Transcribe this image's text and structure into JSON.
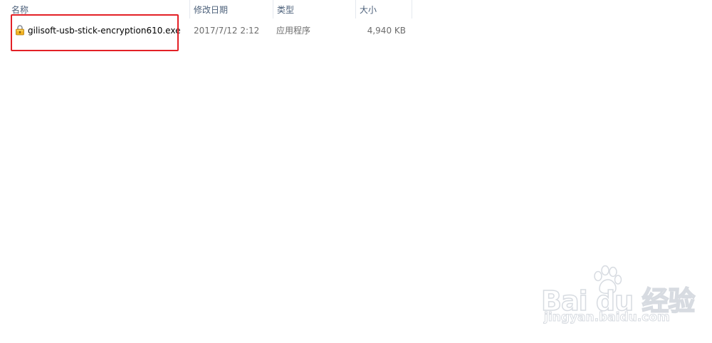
{
  "columns": {
    "name": "名称",
    "modified": "修改日期",
    "type": "类型",
    "size": "大小"
  },
  "sort": {
    "column": "name",
    "direction": "ascending",
    "indicator": "ˆ"
  },
  "files": [
    {
      "name": "gilisoft-usb-stick-encryption610.exe",
      "modified": "2017/7/12 2:12",
      "type": "应用程序",
      "size": "4,940 KB",
      "icon": "lock-icon"
    }
  ],
  "highlight": {
    "color": "#e32026"
  },
  "watermark": {
    "brand": "Bai du 经验",
    "url": "jingyan.baidu.com"
  }
}
